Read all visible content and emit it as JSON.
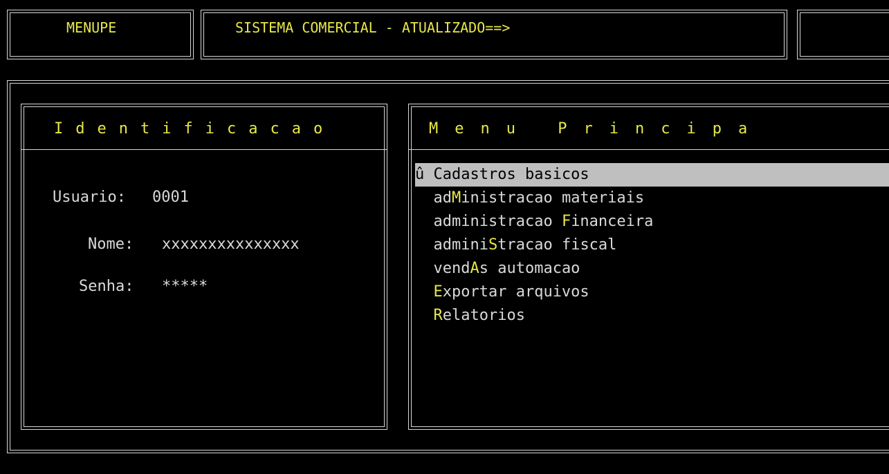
{
  "header": {
    "program_name": "MENUPE",
    "system_title": "SISTEMA COMERCIAL - ATUALIZADO==>"
  },
  "identification": {
    "title": "Identificacao",
    "usuario_label": "Usuario:",
    "usuario_value": "0001",
    "nome_label": "Nome:",
    "nome_value": "xxxxxxxxxxxxxxx",
    "senha_label": "Senha:",
    "senha_value": "*****"
  },
  "main_menu": {
    "title": "Menu Principa",
    "marker": "û",
    "items": [
      {
        "pre": "",
        "key": "",
        "post": "Cadastros basicos",
        "selected": true
      },
      {
        "pre": "ad",
        "key": "M",
        "post": "inistracao materiais",
        "selected": false
      },
      {
        "pre": "administracao ",
        "key": "F",
        "post": "inanceira",
        "selected": false
      },
      {
        "pre": "admini",
        "key": "S",
        "post": "tracao fiscal",
        "selected": false
      },
      {
        "pre": "vend",
        "key": "A",
        "post": "s automacao",
        "selected": false
      },
      {
        "pre": "",
        "key": "E",
        "post": "xportar arquivos",
        "selected": false
      },
      {
        "pre": "",
        "key": "R",
        "post": "elatorios",
        "selected": false
      }
    ]
  },
  "colors": {
    "background": "#000000",
    "text": "#d9d9d9",
    "highlight_text": "#e8e84a",
    "selection_bg": "#bfbfbf"
  }
}
